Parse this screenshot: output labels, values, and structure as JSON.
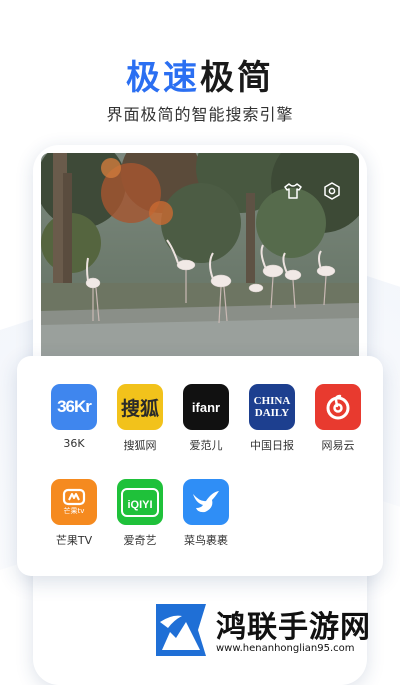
{
  "header": {
    "title_accent": "极速",
    "title_rest": "极简",
    "subtitle": "界面极简的智能搜索引擎"
  },
  "photo_toolbar": {
    "icons": [
      "shirt-icon",
      "gear-icon"
    ]
  },
  "apps": [
    {
      "id": "36k",
      "label": "36K",
      "tile_text": "36Kr",
      "bg": "#3f86ee",
      "fg": "#ffffff"
    },
    {
      "id": "sohu",
      "label": "搜狐网",
      "tile_text": "搜狐",
      "bg": "#f2c21b",
      "fg": "#2a2a2a"
    },
    {
      "id": "ifanr",
      "label": "爱范儿",
      "tile_text": "ifanr",
      "bg": "#111111",
      "fg": "#ffffff"
    },
    {
      "id": "chinadaily",
      "label": "中国日报",
      "tile_text": "CHINA DAILY",
      "bg": "#1d3f8f",
      "fg": "#ffffff"
    },
    {
      "id": "netease",
      "label": "网易云",
      "tile_text": "",
      "bg": "#e83a2f",
      "fg": "#ffffff"
    },
    {
      "id": "mango",
      "label": "芒果TV",
      "tile_text": "芒果tv",
      "bg": "#f58a1f",
      "fg": "#ffffff"
    },
    {
      "id": "iqiyi",
      "label": "爱奇艺",
      "tile_text": "iQIYI",
      "bg": "#1fc13a",
      "fg": "#ffffff"
    },
    {
      "id": "cainiao",
      "label": "菜鸟裹裹",
      "tile_text": "",
      "bg": "#2f8ef6",
      "fg": "#ffffff"
    }
  ],
  "watermark": {
    "name": "鸿联手游网",
    "url": "www.henanhonglian95.com"
  }
}
